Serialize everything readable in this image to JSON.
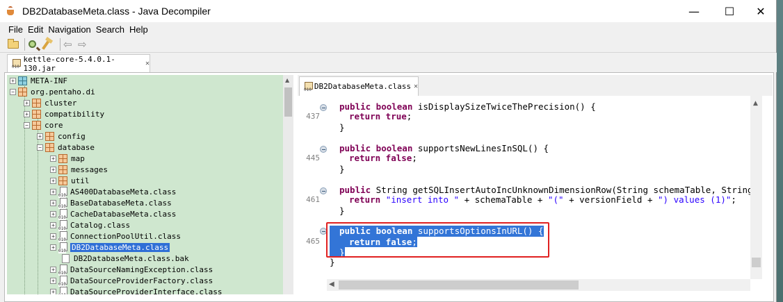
{
  "window": {
    "title": "DB2DatabaseMeta.class - Java Decompiler",
    "controls": {
      "minimize": "—",
      "maximize": "☐",
      "close": "✕"
    }
  },
  "menubar": {
    "items": [
      "File",
      "Edit",
      "Navigation",
      "Search",
      "Help"
    ]
  },
  "toolbar": {
    "back": "⇦",
    "forward": "⇨"
  },
  "outer_tab": {
    "label": "kettle-core-5.4.0.1-130.jar",
    "close": "✕"
  },
  "tree": {
    "rows": [
      {
        "label": "META-INF"
      },
      {
        "label": "org.pentaho.di"
      },
      {
        "label": "cluster"
      },
      {
        "label": "compatibility"
      },
      {
        "label": "core"
      },
      {
        "label": "config"
      },
      {
        "label": "database"
      },
      {
        "label": "map"
      },
      {
        "label": "messages"
      },
      {
        "label": "util"
      },
      {
        "label": "AS400DatabaseMeta.class"
      },
      {
        "label": "BaseDatabaseMeta.class"
      },
      {
        "label": "CacheDatabaseMeta.class"
      },
      {
        "label": "Catalog.class"
      },
      {
        "label": "ConnectionPoolUtil.class"
      },
      {
        "label": "DB2DatabaseMeta.class"
      },
      {
        "label": "DB2DatabaseMeta.class.bak"
      },
      {
        "label": "DataSourceNamingException.class"
      },
      {
        "label": "DataSourceProviderFactory.class"
      },
      {
        "label": "DataSourceProviderInterface.class"
      }
    ],
    "selected": "DB2DatabaseMeta.class"
  },
  "editor": {
    "tab_label": "DB2DatabaseMeta.class",
    "tab_close": "✕",
    "line_numbers": [
      "437",
      "445",
      "461",
      "465"
    ],
    "lines": {
      "m1_sig_kw": "public boolean",
      "m1_sig": " isDisplaySizeTwiceThePrecision() {",
      "m1_ret_kw": "return true",
      "m1_ret": ";",
      "m1_close": "}",
      "m2_sig_kw": "public boolean",
      "m2_sig": " supportsNewLinesInSQL() {",
      "m2_ret_kw": "return false",
      "m2_ret": ";",
      "m2_close": "}",
      "m3_sig_kw": "public",
      "m3_sig": " String getSQLInsertAutoIncUnknownDimensionRow(String schemaTable, String keyFi",
      "m3_ret_kw": "return",
      "m3_ret_a": " ",
      "m3_str1": "\"insert into \"",
      "m3_ret_b": " + schemaTable + ",
      "m3_str2": "\"(\"",
      "m3_ret_c": " + versionField + ",
      "m3_str3": "\") values (1)\"",
      "m3_ret_d": ";",
      "m3_close": "}",
      "m4_sig_kw": "public boolean",
      "m4_sig": " supportsOptionsInURL() {",
      "m4_ret_kw": "return false",
      "m4_ret": ";",
      "m4_close": "}",
      "class_close": "}"
    }
  }
}
